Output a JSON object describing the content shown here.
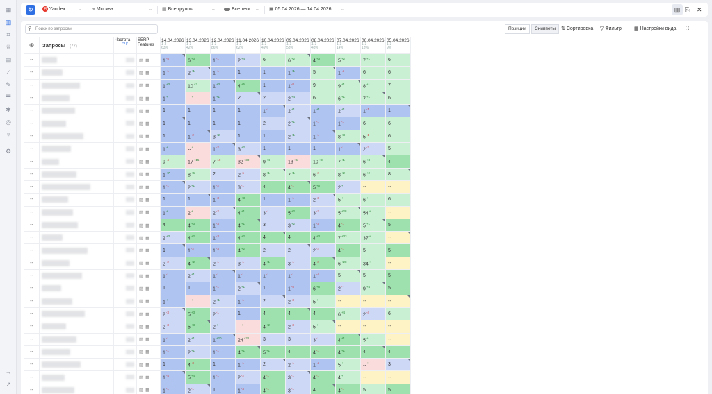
{
  "toolbar": {
    "engine": "Yandex",
    "region": "Москва",
    "groups": "Все группы",
    "tags": "Все теги",
    "date_range": "05.04.2026 — 14.04.2026"
  },
  "search": {
    "placeholder": "Поиск по запросам"
  },
  "view_tabs": {
    "positions": "Позиции",
    "snippets": "Сниппеты",
    "active": "Сниппеты"
  },
  "actions": {
    "sort": "Сортировка",
    "filter": "Фильтр",
    "view_settings": "Настройки вида"
  },
  "columns": {
    "queries": "Запросы",
    "queries_count": "(77)",
    "frequency": "Частота",
    "frequency_sub": "\"!Ч\"",
    "serp": "SERP Features"
  },
  "dates": [
    {
      "date": "14.04.2026",
      "top": "1-3",
      "pct": "63%"
    },
    {
      "date": "13.04.2026",
      "top": "1-3",
      "pct": "42%"
    },
    {
      "date": "12.04.2026",
      "top": "1-3",
      "pct": "86%"
    },
    {
      "date": "11.04.2026",
      "top": "1-3",
      "pct": "62%"
    },
    {
      "date": "10.04.2026",
      "top": "1-3",
      "pct": "49%"
    },
    {
      "date": "09.04.2026",
      "top": "1-3",
      "pct": "53%"
    },
    {
      "date": "08.04.2026",
      "top": "1-3",
      "pct": "48%"
    },
    {
      "date": "07.04.2026",
      "top": "1-3",
      "pct": "14%"
    },
    {
      "date": "06.04.2026",
      "top": "1-3",
      "pct": "13%"
    },
    {
      "date": "05.04.2026",
      "top": "1-3",
      "pct": "9%"
    }
  ],
  "colors": {
    "blue": "#b0c4f2",
    "lightblue": "#cdd8f7",
    "green": "#9ee0ae",
    "lightgreen": "#c9f0d3",
    "pink": "#fbdcdc",
    "yellow": "#fdf3c4",
    "accent": "#2f6fe4"
  },
  "rows": [
    [
      "1|-5|b",
      "6|+3|g",
      "1|-1|b",
      "2|+4|lb",
      "6||lg",
      "6|+2|lg",
      "4|+3|g",
      "5|+2|lg",
      "7|+1|lg",
      "6||lg"
    ],
    [
      "1|-1|b",
      "2|+1|lb",
      "1|-1|b",
      "1||b",
      "1||b",
      "1|+1|b",
      "5||lg",
      "1|-4|b",
      "6||lg",
      "6||lg"
    ],
    [
      "1|+3|b",
      "10|+3|lg",
      "1|+3|b",
      "4|+5|g",
      "1||b",
      "1|-8|b",
      "9||lg",
      "9|+1|lg",
      "8|+1|lg",
      "7||lg"
    ],
    [
      "1|+|b",
      "--|+|p",
      "1|+1|b",
      "2||lb",
      "2||lb",
      "2|+4|lb",
      "6||lg",
      "6|+1|lg",
      "7|+1|lg",
      "6||lg"
    ],
    [
      "1||b",
      "1||b",
      "1||b",
      "1||b",
      "1|-1|b",
      "2|+1|lb",
      "1|+1|b",
      "2|+1|lb",
      "1|-1|b",
      "1||b"
    ],
    [
      "1||b",
      "1||b",
      "1||b",
      "1||b",
      "2||lb",
      "2|+1|lb",
      "1|-1|b",
      "1|-1|b",
      "6||lg",
      "6||lg"
    ],
    [
      "1||b",
      "1|-2|b",
      "3|+2|lb",
      "1||b",
      "1||b",
      "2|+1|lb",
      "1|-1|b",
      "8|+3|lg",
      "5|-1|lg",
      "6||lg"
    ],
    [
      "1|+|b",
      "--|+|p",
      "1|-2|b",
      "3|+2|lb",
      "1||b",
      "1||b",
      "1||b",
      "1|-1|b",
      "2|-3|lb",
      "5||lg"
    ],
    [
      "9|-4|lg",
      "17|+15|p",
      "7|-10|lg",
      "32|+30|p",
      "9|+4|lg",
      "13|+5|p",
      "10|+9|lg",
      "7|+1|lg",
      "6|+3|lg",
      "4||g"
    ],
    [
      "1|+7|b",
      "8|+6|lg",
      "2||lb",
      "2|-6|lb",
      "8|+1|lg",
      "7|+1|lg",
      "6|-2|lg",
      "8|+2|lg",
      "6|+2|lg",
      "8||lg"
    ],
    [
      "1|-1|b",
      "2|+1|lb",
      "1|-2|b",
      "3|-1|lb",
      "4||g",
      "4|-1|g",
      "5|+5|g",
      "2|+|lb",
      "--||y",
      "--||y"
    ],
    [
      "1||b",
      "1||b",
      "1|-3|b",
      "4|+3|g",
      "1||b",
      "1|-1|b",
      "2|-3|lb",
      "5|+|lg",
      "6|+|lg",
      "6||lg"
    ],
    [
      "1|+|b",
      "2|+|p",
      "2|-2|lb",
      "4|+1|g",
      "3|-1|lb",
      "5|+2|g",
      "3|-2|lb",
      "5|+28|lg",
      "54|+|lg",
      "--||y"
    ],
    [
      "4||g",
      "4|+3|g",
      "1|-3|b",
      "4|+1|g",
      "3||lb",
      "3|+2|lb",
      "1|-3|b",
      "4|-1|g",
      "5|+1|lg",
      "5||g"
    ],
    [
      "2|+3|lb",
      "4|+2|g",
      "1|-3|b",
      "4|+2|g",
      "4||g",
      "4||g",
      "4|+3|g",
      "7|+33|lg",
      "37|+|lg",
      "--||y"
    ],
    [
      "1||b",
      "1|-2|b",
      "1|-3|b",
      "4|+2|g",
      "2||lb",
      "2||lb",
      "2|-2|lb",
      "4|-1|g",
      "5||lg",
      "5||g"
    ],
    [
      "2|-2|lb",
      "4|+2|g",
      "2|-1|lb",
      "3|-1|lb",
      "4|+1|g",
      "3|-1|lb",
      "4|-2|g",
      "6|+28|lg",
      "34|+|lg",
      "--||y"
    ],
    [
      "1|-1|b",
      "2|+1|lb",
      "1|-1|b",
      "1|-1|b",
      "1|-1|b",
      "1|-1|b",
      "1|-4|b",
      "5||lg",
      "5||lg",
      "5||g"
    ],
    [
      "1||b",
      "1||b",
      "1|-1|b",
      "2|+1|lb",
      "1||b",
      "1|-5|b",
      "6|+8|g",
      "2|-7|lb",
      "9|+4|lg",
      "5||g"
    ],
    [
      "1|+|b",
      "--|+|p",
      "2|+1|lb",
      "1|-1|b",
      "2||lb",
      "2|-3|lb",
      "5|+|lg",
      "--||y",
      "--||y",
      "--||y"
    ],
    [
      "2|-3|lb",
      "5|+3|g",
      "2|-1|lb",
      "1||b",
      "4||g",
      "4||g",
      "4||g",
      "6|+4|lg",
      "2|-4|lb",
      "6||lg"
    ],
    [
      "2|-3|lb",
      "5|+3|g",
      "2|+|lb",
      "--|+|p",
      "4|+2|g",
      "2|-3|lb",
      "5|+|lg",
      "--||y",
      "--||y",
      "--||y"
    ],
    [
      "1|-1|b",
      "2|+1|lb",
      "1|+20|b",
      "24|+21|p",
      "3||lb",
      "3||lb",
      "3|-1|lb",
      "4|+1|g",
      "5|+|lg",
      "--||y"
    ],
    [
      "1|-1|b",
      "2|+1|lb",
      "1|-1|b",
      "4|+1|g",
      "5|+1|g",
      "4||g",
      "4|-1|g",
      "4|+1|g",
      "4||g",
      "4||g"
    ],
    [
      "1||b",
      "4|-3|g",
      "1||b",
      "1|-1|b",
      "2||lb",
      "2|-1|lb",
      "1|-4|b",
      "5|+|lg",
      "--|+|p",
      "3||lb"
    ],
    [
      "1|-4|b",
      "5|+4|g",
      "1|-1|b",
      "2|-2|lb",
      "4|-1|g",
      "3|-1|lb",
      "4|-1|g",
      "4|+|lg",
      "--||y",
      "--||y"
    ],
    [
      "1|-1|b",
      "2|-1|lb",
      "1||b",
      "1|-3|b",
      "4|-1|g",
      "3|-1|lb",
      "4||g",
      "4|-1|g",
      "5||lg",
      "5||g"
    ]
  ],
  "row_dash": "--"
}
